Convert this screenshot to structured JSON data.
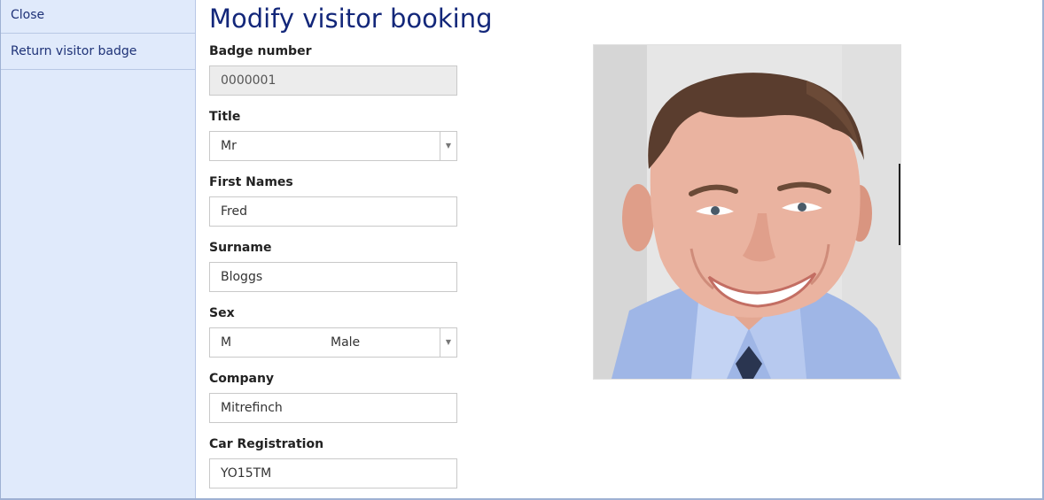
{
  "sidebar": {
    "items": [
      {
        "label": "Close"
      },
      {
        "label": "Return visitor badge"
      }
    ]
  },
  "page": {
    "title": "Modify visitor booking"
  },
  "form": {
    "badge_number": {
      "label": "Badge number",
      "value": "0000001"
    },
    "title": {
      "label": "Title",
      "value": "Mr"
    },
    "first_names": {
      "label": "First Names",
      "value": "Fred"
    },
    "surname": {
      "label": "Surname",
      "value": "Bloggs"
    },
    "sex": {
      "label": "Sex",
      "code": "M",
      "value": "Male"
    },
    "company": {
      "label": "Company",
      "value": "Mitrefinch"
    },
    "car_registration": {
      "label": "Car Registration",
      "value": "YO15TM"
    }
  },
  "icons": {
    "dropdown": "chevron-down-icon"
  },
  "colors": {
    "sidebar_bg": "#e0eafb",
    "title": "#13277a",
    "link": "#1e3277"
  }
}
